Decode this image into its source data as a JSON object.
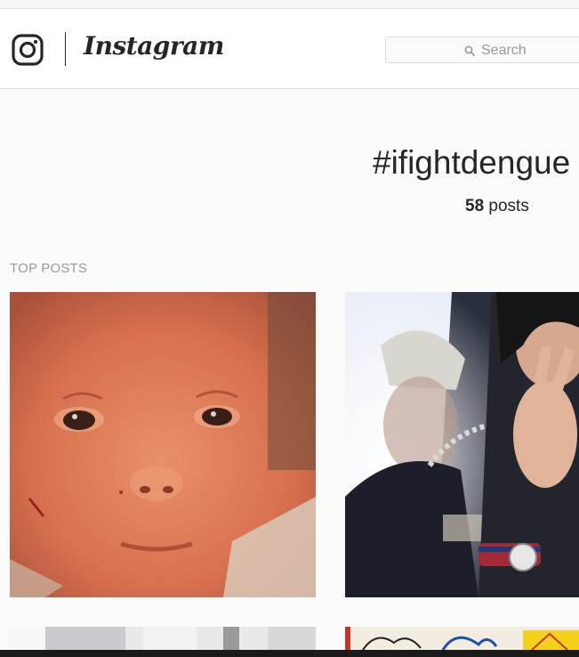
{
  "app": {
    "wordmark": "Instagram"
  },
  "search": {
    "placeholder": "Search",
    "icon": "search-icon"
  },
  "hashtag": {
    "title": "#ifightdengue",
    "post_count": "58",
    "post_count_label": "posts"
  },
  "top_posts": {
    "section_label": "TOP POSTS",
    "posts": [
      {
        "alt": "baby face close-up"
      },
      {
        "alt": "selfie with peace sign"
      },
      {
        "alt": ""
      },
      {
        "alt": ""
      }
    ]
  },
  "colors": {
    "text": "#262626",
    "muted": "#999999",
    "border": "#dbdbdb",
    "background": "#fafafa"
  }
}
